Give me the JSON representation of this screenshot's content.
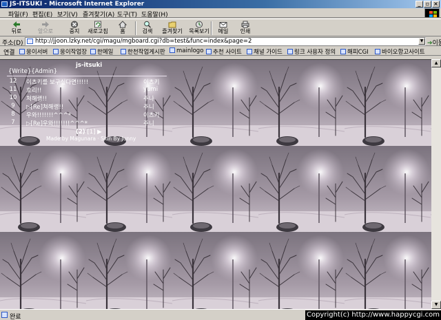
{
  "window": {
    "title": "JS-ITSUKI - Microsoft Internet Explorer"
  },
  "menu": [
    "파일(F)",
    "편집(E)",
    "보기(V)",
    "즐겨찾기(A)",
    "도구(T)",
    "도움말(H)"
  ],
  "toolbar": {
    "back": "뒤로",
    "forward": "앞으로",
    "stop": "중지",
    "refresh": "새로고침",
    "home": "홈",
    "search": "검색",
    "favorites": "즐겨찾기",
    "history": "목록보기",
    "mail": "메일",
    "print": "인쇄"
  },
  "address": {
    "label": "주소(D)",
    "url": "http://jjoon.lzky.net/cgi/magu/mgboard.cgi?db=test&func=index&page=2",
    "go": "이동"
  },
  "links": {
    "label": "연결",
    "items": [
      "웅이서버",
      "웅이작업장",
      "한메일",
      "한천작업게시판",
      "mainlogo",
      "추천 사이트",
      "채널 가이드",
      "링크 사용자 정의",
      "해피CGI",
      "바이오항고사이트"
    ]
  },
  "board": {
    "title": "js-itsuki",
    "admin": "{Write}{Admin}",
    "posts": [
      {
        "num": "12",
        "subject": "이츠키를 보구싶다면!!!!!",
        "author": "이츠키"
      },
      {
        "num": "11",
        "subject": "호리!!",
        "author": "yumi"
      },
      {
        "num": "10",
        "subject": "쳐해랭!!",
        "author": "주나"
      },
      {
        "num": "9",
        "subject": "▷[Re]쳐해랭!!",
        "author": "주니"
      },
      {
        "num": "8",
        "subject": "우와!!!!!!!^^^*",
        "author": "이츠키"
      },
      {
        "num": "7",
        "subject": "▷[Re]우와!!!!!!!^^^*",
        "author": "주니"
      }
    ],
    "pager": {
      "current": "(2)",
      "next": "[1]",
      "arrow": "▶"
    },
    "credit": "Made by Magunara · Skin By Junny"
  },
  "status": {
    "text": "완료",
    "copyright": "Copyright(c) http://www.happycgi.com"
  },
  "colors": {
    "titlebar": "#0a246a",
    "chrome": "#d4d0c8",
    "board_bg": "#8e8691"
  }
}
